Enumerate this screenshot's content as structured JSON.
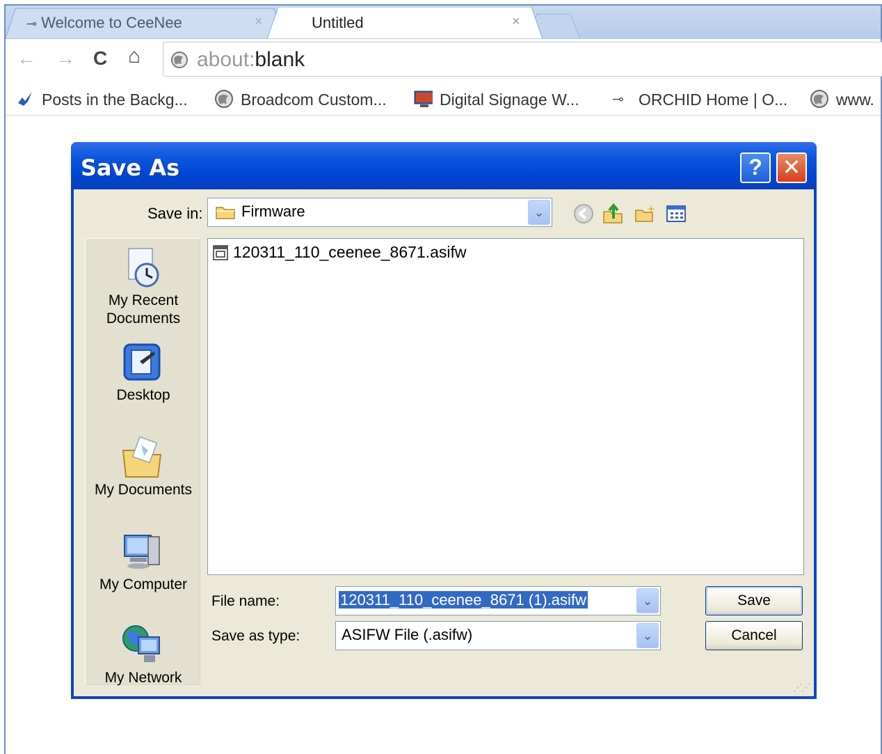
{
  "browser": {
    "tabs": [
      {
        "title": "Welcome to CeeNee",
        "close": "×"
      },
      {
        "title": "Untitled",
        "close": "×"
      }
    ],
    "nav": {
      "back": "←",
      "forward": "→",
      "reload": "C",
      "home": "⌂"
    },
    "address": {
      "scheme": "about:",
      "rest": "blank"
    },
    "bookmarks": [
      {
        "label": "Posts in the Backg...",
        "icon": "wordpress-icon"
      },
      {
        "label": "Broadcom Custom...",
        "icon": "globe-icon"
      },
      {
        "label": "Digital Signage W...",
        "icon": "monitor-icon"
      },
      {
        "label": "ORCHID Home | O...",
        "icon": "plug-icon"
      },
      {
        "label": "www.",
        "icon": "globe-icon"
      }
    ]
  },
  "dialog": {
    "title": "Save As",
    "help_label": "?",
    "close_label": "✕",
    "save_in": {
      "label": "Save in:",
      "value": "Firmware"
    },
    "places": [
      {
        "label_line1": "My Recent",
        "label_line2": "Documents"
      },
      {
        "label_line1": "Desktop",
        "label_line2": ""
      },
      {
        "label_line1": "My Documents",
        "label_line2": ""
      },
      {
        "label_line1": "My Computer",
        "label_line2": ""
      },
      {
        "label_line1": "My Network",
        "label_line2": ""
      }
    ],
    "files": [
      {
        "name": "120311_110_ceenee_8671.asifw"
      }
    ],
    "file_name": {
      "label": "File name:",
      "value": "120311_110_ceenee_8671 (1).asifw"
    },
    "save_as_type": {
      "label": "Save as type:",
      "value": "ASIFW File (.asifw)"
    },
    "buttons": {
      "save": "Save",
      "cancel": "Cancel"
    }
  },
  "colors": {
    "titlebar": "#0054e3",
    "dialog_body": "#ece9d8",
    "selection": "#316ac5",
    "close_button": "#d6401c"
  }
}
